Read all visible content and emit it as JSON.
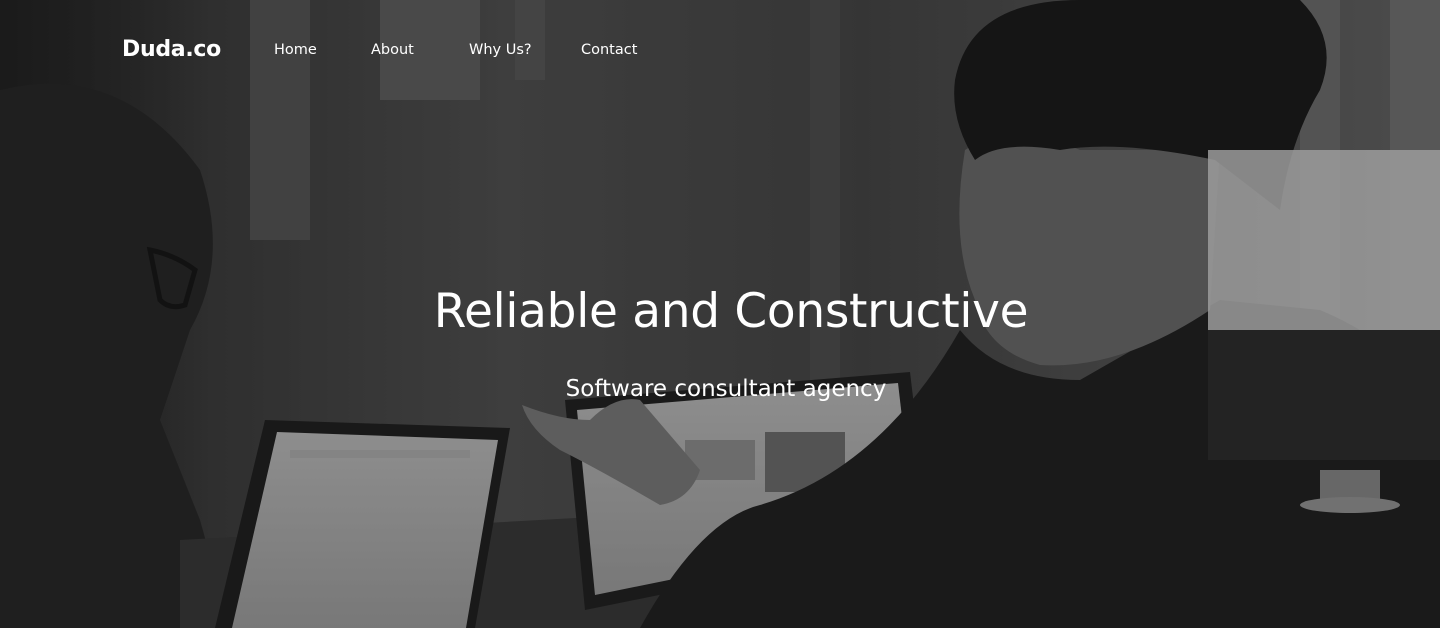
{
  "nav": {
    "logo": "Duda.co",
    "links": [
      "Home",
      "About",
      "Why Us?",
      "Contact"
    ]
  },
  "hero": {
    "headline": "Reliable and Constructive",
    "subheadline": "Software consultant agency"
  },
  "theme": {
    "text_color": "#ffffff",
    "background_tone": "#3a3a3a"
  }
}
